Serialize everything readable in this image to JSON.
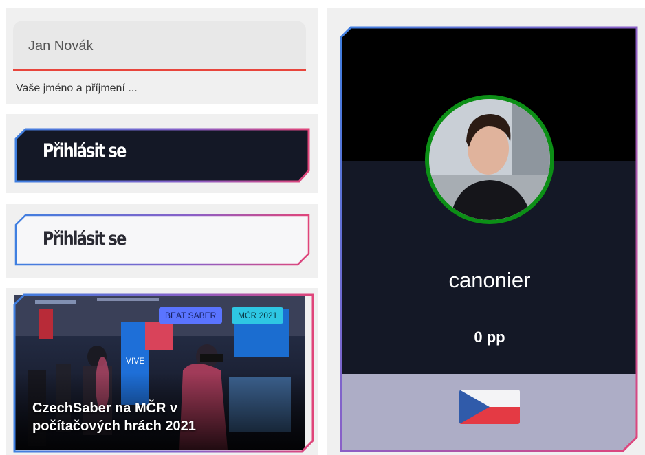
{
  "form": {
    "name_value": "Jan Novák",
    "name_hint": "Vaše jméno a příjmení ..."
  },
  "buttons": {
    "login_filled_label": "Přihlásit se",
    "login_outline_label": "Přihlásit se"
  },
  "news": {
    "tags": [
      "BEAT SABER",
      "MČR 2021"
    ],
    "title": "CzechSaber na MČR v počítačových hrách 2021",
    "image_sign_text": "VIVE"
  },
  "profile": {
    "username": "canonier",
    "pp": "0 pp",
    "country_flag": "czech-flag"
  },
  "colors": {
    "accent_red": "#e8453c",
    "gradient_blue": "#3f7fe0",
    "gradient_pink": "#e0457a",
    "avatar_ring": "#0c8f16",
    "card_dark": "#141826"
  }
}
